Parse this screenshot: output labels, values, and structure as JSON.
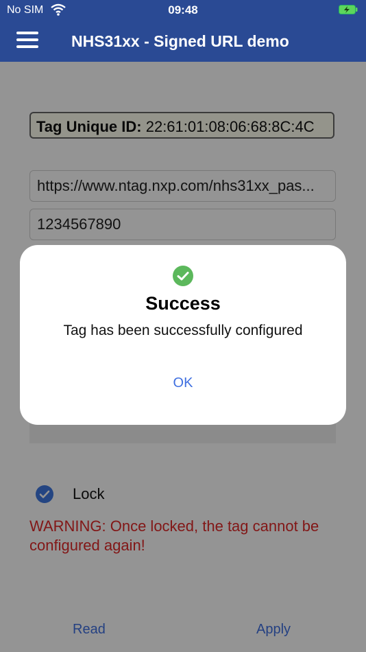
{
  "status_bar": {
    "carrier": "No SIM",
    "time": "09:48"
  },
  "nav": {
    "title": "NHS31xx - Signed URL demo"
  },
  "form": {
    "uid_label": "Tag Unique ID:",
    "uid_value": "22:61:01:08:06:68:8C:4C",
    "url_value": "https://www.ntag.nxp.com/nhs31xx_pas...",
    "key_value": "1234567890",
    "lock_label": "Lock",
    "lock_checked": true,
    "warning": "WARNING: Once locked, the tag cannot be configured again!"
  },
  "actions": {
    "read_label": "Read",
    "apply_label": "Apply"
  },
  "dialog": {
    "title": "Success",
    "message": "Tag has been successfully configured",
    "ok_label": "OK"
  },
  "colors": {
    "bar": "#2a4a94",
    "accent": "#3f6fe0",
    "warning": "#e02828",
    "success": "#5cb85c"
  }
}
